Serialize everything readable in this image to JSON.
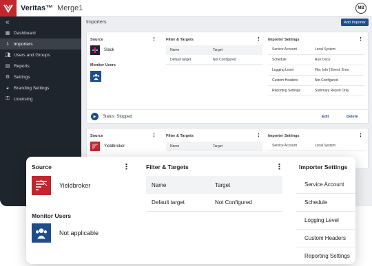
{
  "brand": {
    "name": "Veritas™",
    "product": "Merge1",
    "logo_icon": "veritas-logo",
    "user_initials": "MB"
  },
  "sidebar": {
    "collapse_icon": "«",
    "items": [
      {
        "label": "Dashboard",
        "icon": "dashboard-icon",
        "active": false
      },
      {
        "label": "Importers",
        "icon": "importers-icon",
        "active": true
      },
      {
        "label": "Users and Groups",
        "icon": "users-icon",
        "active": false
      },
      {
        "label": "Reports",
        "icon": "reports-icon",
        "active": false
      },
      {
        "label": "Settings",
        "icon": "gear-icon",
        "active": false
      },
      {
        "label": "Branding Settings",
        "icon": "palette-icon",
        "active": false
      },
      {
        "label": "Licensing",
        "icon": "license-icon",
        "active": false
      }
    ]
  },
  "main": {
    "title": "Importers",
    "add_button": "Add Importer"
  },
  "card1": {
    "source_heading": "Source",
    "source_name": "Slack",
    "monitor_heading": "Monitor Users",
    "filter_heading": "Filter & Targets",
    "table_headers": [
      "Name",
      "Target"
    ],
    "table_rows": [
      [
        "Default target",
        "Not Configured"
      ]
    ],
    "settings_heading": "Importer Settings",
    "settings": [
      [
        "Service Account",
        "Local System"
      ],
      [
        "Schedule",
        "Run Once"
      ],
      [
        "Logging Level",
        "File: Info | Event: Error"
      ],
      [
        "Custom Headers",
        "Not Configured"
      ],
      [
        "Reporting Settings",
        "Summary Report Only"
      ]
    ],
    "status": "Status: Stopped",
    "edit_label": "Edit",
    "delete_label": "Delete"
  },
  "card2": {
    "source_heading": "Source",
    "source_name": "Yieldbroker",
    "filter_heading": "Filter & Targets",
    "table_headers": [
      "Name",
      "Target"
    ],
    "settings_heading": "Importer Settings",
    "settings": [
      [
        "Service Account",
        "Local System"
      ]
    ]
  },
  "zoom": {
    "source_heading": "Source",
    "source_name": "Yieldbroker",
    "monitor_heading": "Monitor Users",
    "monitor_value": "Not applicable",
    "filter_heading": "Filter & Targets",
    "table_headers": [
      "Name",
      "Target"
    ],
    "table_rows": [
      [
        "Default target",
        "Not Configured"
      ]
    ],
    "settings_heading": "Importer Settings",
    "settings": [
      "Service Account",
      "Schedule",
      "Logging Level",
      "Custom Headers",
      "Reporting Settings"
    ]
  },
  "colors": {
    "sidebar": "#1f252d",
    "accent": "#1e4d8b",
    "brand_red": "#c1272d"
  }
}
